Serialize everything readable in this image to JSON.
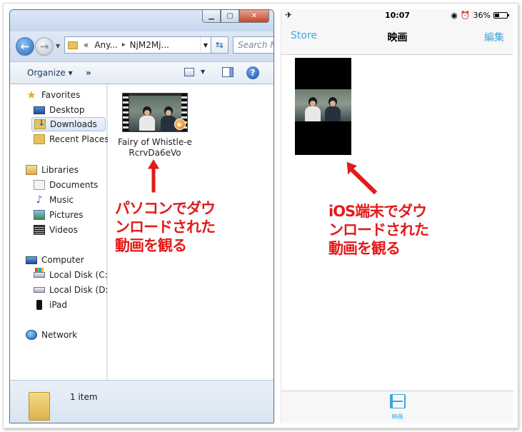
{
  "explorer": {
    "address": {
      "chevrons": "«",
      "crumb_1": "Any...",
      "crumb_sep": "▸",
      "crumb_2": "NjM2Mj..."
    },
    "search_placeholder": "Search N",
    "toolbar": {
      "organize_label": "Organize ▾",
      "more_label": "»"
    },
    "nav": {
      "favorites": "Favorites",
      "desktop": "Desktop",
      "downloads": "Downloads",
      "recent_places": "Recent Places",
      "libraries": "Libraries",
      "documents": "Documents",
      "music": "Music",
      "pictures": "Pictures",
      "videos": "Videos",
      "computer": "Computer",
      "local_disk_c": "Local Disk (C:)",
      "local_disk_d": "Local Disk (D:)",
      "ipad": "iPad",
      "network": "Network"
    },
    "selected_nav": "downloads",
    "file": {
      "name": "Fairy of Whistle-eRcrvDa6eVo"
    },
    "status": {
      "item_count": "1 item"
    }
  },
  "annotations": {
    "pc": "パソコンでダウ\nンロードされた\n動画を観る",
    "ios": "iOS端末でダウ\nンロードされた\n動画を観る",
    "color": "#e21b1b"
  },
  "ios": {
    "status": {
      "time": "10:07",
      "battery": "36%",
      "battery_level": 0.36
    },
    "nav": {
      "back_label": "Store",
      "title": "映画",
      "edit_label": "編集"
    },
    "tab": {
      "label": "映画"
    },
    "accent_color": "#3aa6e3"
  }
}
